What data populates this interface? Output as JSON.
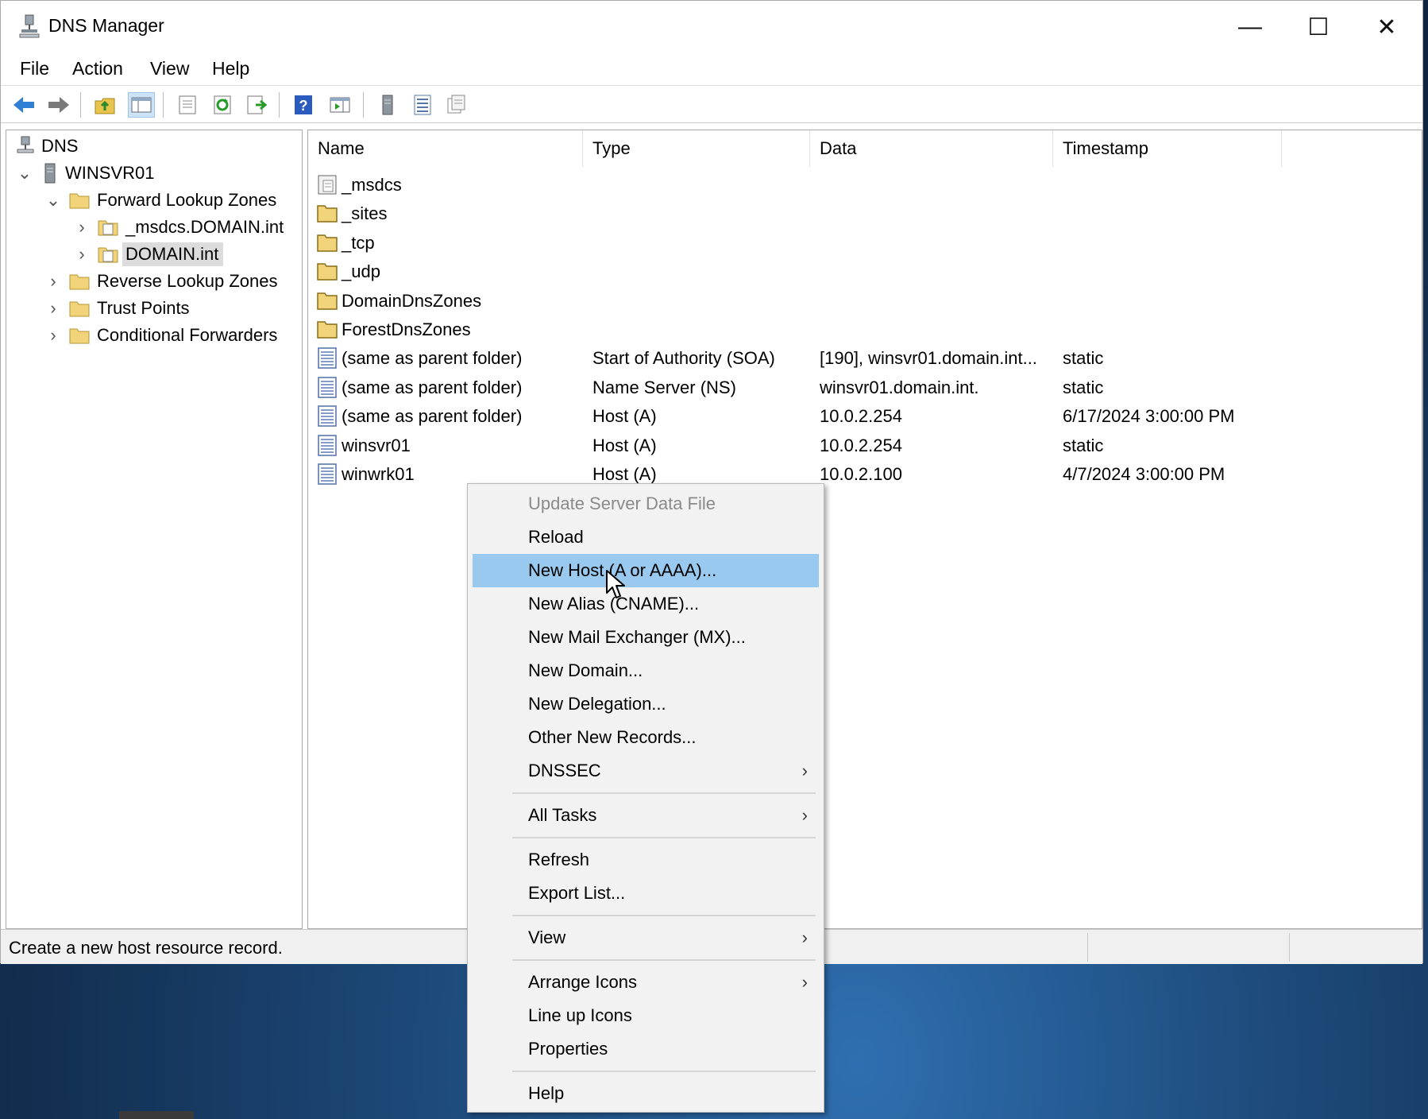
{
  "window": {
    "title": "DNS Manager",
    "minimize_glyph": "—",
    "maximize_glyph": "☐",
    "close_glyph": "✕"
  },
  "menu": [
    "File",
    "Action",
    "View",
    "Help"
  ],
  "toolbar": {
    "buttons": [
      "back-icon",
      "forward-icon",
      "up-folder-icon",
      "show-hide-tree-icon",
      "properties-icon",
      "refresh-icon",
      "export-list-icon",
      "help-icon",
      "show-hide-action-pane-icon",
      "server-icon",
      "records-list-icon",
      "zone-icon"
    ]
  },
  "tree": {
    "root": "DNS",
    "server": "WINSVR01",
    "forward": "Forward Lookup Zones",
    "zone_msdcs": "_msdcs.DOMAIN.int",
    "zone_domain": "DOMAIN.int",
    "reverse": "Reverse Lookup Zones",
    "trust": "Trust Points",
    "conditional": "Conditional Forwarders"
  },
  "list": {
    "headers": {
      "name": "Name",
      "type": "Type",
      "data": "Data",
      "timestamp": "Timestamp"
    },
    "rows": [
      {
        "name": "_msdcs",
        "type": "",
        "data": "",
        "timestamp": "",
        "icon": "delegated-folder-icon"
      },
      {
        "name": "_sites",
        "type": "",
        "data": "",
        "timestamp": "",
        "icon": "folder-icon"
      },
      {
        "name": "_tcp",
        "type": "",
        "data": "",
        "timestamp": "",
        "icon": "folder-icon"
      },
      {
        "name": "_udp",
        "type": "",
        "data": "",
        "timestamp": "",
        "icon": "folder-icon"
      },
      {
        "name": "DomainDnsZones",
        "type": "",
        "data": "",
        "timestamp": "",
        "icon": "folder-icon"
      },
      {
        "name": "ForestDnsZones",
        "type": "",
        "data": "",
        "timestamp": "",
        "icon": "folder-icon"
      },
      {
        "name": "(same as parent folder)",
        "type": "Start of Authority (SOA)",
        "data": "[190], winsvr01.domain.int...",
        "timestamp": "static",
        "icon": "record-icon"
      },
      {
        "name": "(same as parent folder)",
        "type": "Name Server (NS)",
        "data": "winsvr01.domain.int.",
        "timestamp": "static",
        "icon": "record-icon"
      },
      {
        "name": "(same as parent folder)",
        "type": "Host (A)",
        "data": "10.0.2.254",
        "timestamp": "6/17/2024 3:00:00 PM",
        "icon": "record-icon"
      },
      {
        "name": "winsvr01",
        "type": "Host (A)",
        "data": "10.0.2.254",
        "timestamp": "static",
        "icon": "record-icon"
      },
      {
        "name": "winwrk01",
        "type": "Host (A)",
        "data": "10.0.2.100",
        "timestamp": "4/7/2024 3:00:00 PM",
        "icon": "record-icon"
      }
    ]
  },
  "status": {
    "text": "Create a new host resource record."
  },
  "context_menu": {
    "update": "Update Server Data File",
    "reload": "Reload",
    "new_host": "New Host (A or AAAA)...",
    "new_alias": "New Alias (CNAME)...",
    "new_mx": "New Mail Exchanger (MX)...",
    "new_domain": "New Domain...",
    "new_delegation": "New Delegation...",
    "other_records": "Other New Records...",
    "dnssec": "DNSSEC",
    "all_tasks": "All Tasks",
    "refresh": "Refresh",
    "export": "Export List...",
    "view": "View",
    "arrange": "Arrange Icons",
    "lineup": "Line up Icons",
    "properties": "Properties",
    "help": "Help",
    "submenu_arrow": "›",
    "highlight_color": "#99c9ef"
  }
}
